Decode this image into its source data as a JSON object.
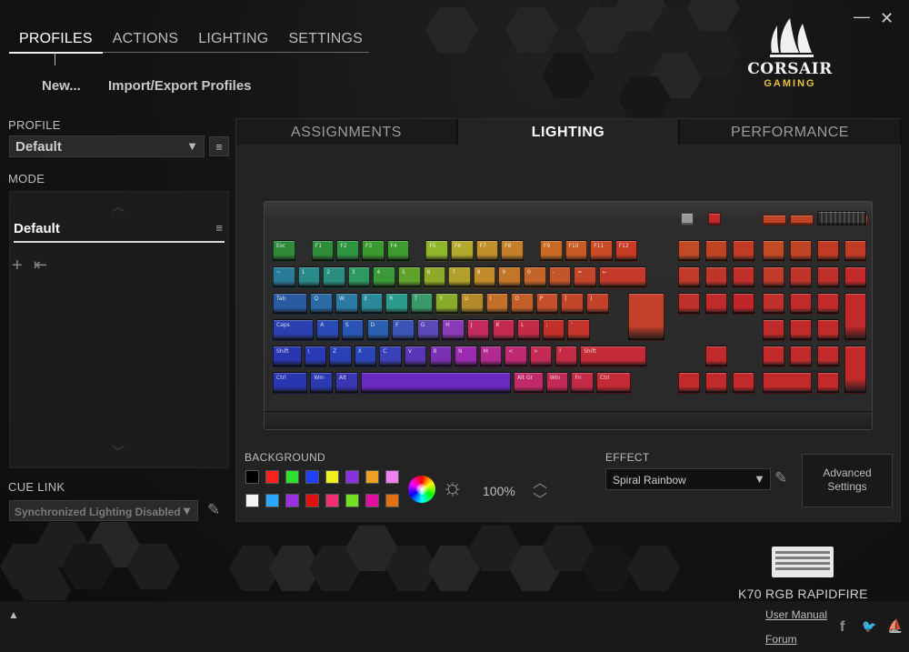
{
  "topnav": {
    "tabs": [
      {
        "label": "PROFILES",
        "active": true
      },
      {
        "label": "ACTIONS",
        "active": false
      },
      {
        "label": "LIGHTING",
        "active": false
      },
      {
        "label": "SETTINGS",
        "active": false
      }
    ],
    "new_label": "New...",
    "import_export_label": "Import/Export Profiles"
  },
  "window": {
    "minimize": "—",
    "close": "✕"
  },
  "logo": {
    "brand": "CORSAIR",
    "sub": "GAMING"
  },
  "profile": {
    "label": "PROFILE",
    "value": "Default",
    "arrow": "▼",
    "menu": "≡"
  },
  "mode": {
    "label": "MODE",
    "name": "Default",
    "menu": "≡",
    "up": "︿",
    "down": "﹀",
    "add": "+",
    "import": "⇤"
  },
  "cue_link": {
    "label": "CUE LINK",
    "value": "Synchronized Lighting Disabled",
    "arrow": "▼",
    "edit": "✎"
  },
  "main_tabs": [
    {
      "label": "ASSIGNMENTS",
      "active": false
    },
    {
      "label": "LIGHTING",
      "active": true
    },
    {
      "label": "PERFORMANCE",
      "active": false
    }
  ],
  "background": {
    "label": "BACKGROUND",
    "swatches": [
      "#000000",
      "#ff2020",
      "#30e030",
      "#2040ff",
      "#f0f020",
      "#8a30e0",
      "#f0a020",
      "#f080f0",
      "#f4f4f4",
      "#2aa8ff",
      "#9a30e0",
      "#e01010",
      "#f03070",
      "#70e020",
      "#e010a0",
      "#e07010"
    ],
    "brightness": "100%",
    "brightness_up": "︿",
    "brightness_down": "﹀",
    "sun": "☼"
  },
  "effect": {
    "label": "EFFECT",
    "value": "Spiral Rainbow",
    "arrow": "▼",
    "edit": "✎"
  },
  "advanced": {
    "line1": "Advanced",
    "line2": "Settings"
  },
  "device": {
    "name": "K70 RGB RAPIDFIRE"
  },
  "footer": {
    "expand": "▲",
    "manual": "User Manual",
    "forum": "Forum",
    "facebook": "f",
    "twitter": "🐦",
    "corsair": "⛵"
  },
  "keyboard": {
    "rows": [
      {
        "y": 0,
        "keys": [
          [
            "Esc",
            "#2f8a3a",
            1
          ],
          [
            "",
            null,
            0.55
          ],
          [
            "F1",
            "#2e8c3a",
            1
          ],
          [
            "F2",
            "#2f9440",
            1
          ],
          [
            "F3",
            "#3a9a2f",
            1
          ],
          [
            "F4",
            "#3f9a2f",
            1
          ],
          [
            "",
            null,
            0.55
          ],
          [
            "F5",
            "#8fb52a",
            1
          ],
          [
            "F6",
            "#b3a92a",
            1
          ],
          [
            "F7",
            "#c38f2a",
            1
          ],
          [
            "F8",
            "#c37f2a",
            1
          ],
          [
            "",
            null,
            0.55
          ],
          [
            "F9",
            "#c96a24",
            1
          ],
          [
            "F10",
            "#c95a24",
            1
          ],
          [
            "F11",
            "#c94a24",
            1
          ],
          [
            "F12",
            "#c93a24",
            1
          ]
        ]
      },
      {
        "y": 1,
        "keys": [
          [
            "~",
            "#2a7a9a",
            1
          ],
          [
            "1",
            "#2a8a8a",
            1
          ],
          [
            "2",
            "#2a8f7f",
            1
          ],
          [
            "3",
            "#2f9a5f",
            1
          ],
          [
            "4",
            "#3a9a3a",
            1
          ],
          [
            "5",
            "#5fa32a",
            1
          ],
          [
            "6",
            "#8faa2a",
            1
          ],
          [
            "7",
            "#b3a02a",
            1
          ],
          [
            "8",
            "#c38a2a",
            1
          ],
          [
            "9",
            "#c3752a",
            1
          ],
          [
            "0",
            "#c3652a",
            1
          ],
          [
            "-",
            "#c3552a",
            1
          ],
          [
            "=",
            "#c3452a",
            1
          ],
          [
            "←",
            "#c33a2a",
            2
          ]
        ]
      },
      {
        "y": 2,
        "keys": [
          [
            "Tab",
            "#2a5aa0",
            1.5
          ],
          [
            "Q",
            "#2a6aa5",
            1
          ],
          [
            "W",
            "#2a7aa5",
            1
          ],
          [
            "E",
            "#2a8a9a",
            1
          ],
          [
            "R",
            "#2a9a8a",
            1
          ],
          [
            "T",
            "#3a9a6a",
            1
          ],
          [
            "Y",
            "#8aaa2a",
            1
          ],
          [
            "U",
            "#b38a2a",
            1
          ],
          [
            "I",
            "#c3702a",
            1
          ],
          [
            "O",
            "#c3602a",
            1
          ],
          [
            "P",
            "#c3502a",
            1
          ],
          [
            "[",
            "#c3452a",
            1
          ],
          [
            "]",
            "#c3402a",
            1
          ]
        ]
      },
      {
        "y": 3,
        "keys": [
          [
            "Caps",
            "#2a40b0",
            1.75
          ],
          [
            "A",
            "#2a4ab5",
            1
          ],
          [
            "S",
            "#2a55b5",
            1
          ],
          [
            "D",
            "#2a60b0",
            1
          ],
          [
            "F",
            "#3a55b5",
            1
          ],
          [
            "G",
            "#5a4ab5",
            1
          ],
          [
            "H",
            "#8a3ab5",
            1
          ],
          [
            "J",
            "#c32a60",
            1
          ],
          [
            "K",
            "#c32a50",
            1
          ],
          [
            "L",
            "#c32a45",
            1
          ],
          [
            ";",
            "#c3302a",
            1
          ],
          [
            "'",
            "#c3352a",
            1
          ]
        ]
      },
      {
        "y": 4,
        "keys": [
          [
            "Shift",
            "#2a35b0",
            1.25
          ],
          [
            "\\",
            "#2a3ab5",
            1
          ],
          [
            "Z",
            "#2a40b5",
            1
          ],
          [
            "X",
            "#2a45b5",
            1
          ],
          [
            "C",
            "#3a40b5",
            1
          ],
          [
            "V",
            "#5a35b5",
            1
          ],
          [
            "B",
            "#7a30b0",
            1
          ],
          [
            "N",
            "#9a2ab0",
            1
          ],
          [
            "M",
            "#b02a90",
            1
          ],
          [
            "<",
            "#c02a70",
            1
          ],
          [
            ">",
            "#c32a55",
            1
          ],
          [
            "?",
            "#c32a45",
            1
          ],
          [
            "Shift",
            "#c32a35",
            2.75
          ]
        ]
      },
      {
        "y": 5,
        "keys": [
          [
            "Ctrl",
            "#2a35b0",
            1.5
          ],
          [
            "Win",
            "#2a3ab0",
            1
          ],
          [
            "Alt",
            "#3a35b0",
            1
          ],
          [
            "",
            "#6a2ac0",
            6.1
          ],
          [
            "Alt Gr",
            "#c02a6a",
            1.3
          ],
          [
            "Win",
            "#c32a55",
            1
          ],
          [
            "Fn",
            "#c32a45",
            1
          ],
          [
            "Ctrl",
            "#c32a35",
            1.5
          ]
        ]
      }
    ]
  }
}
